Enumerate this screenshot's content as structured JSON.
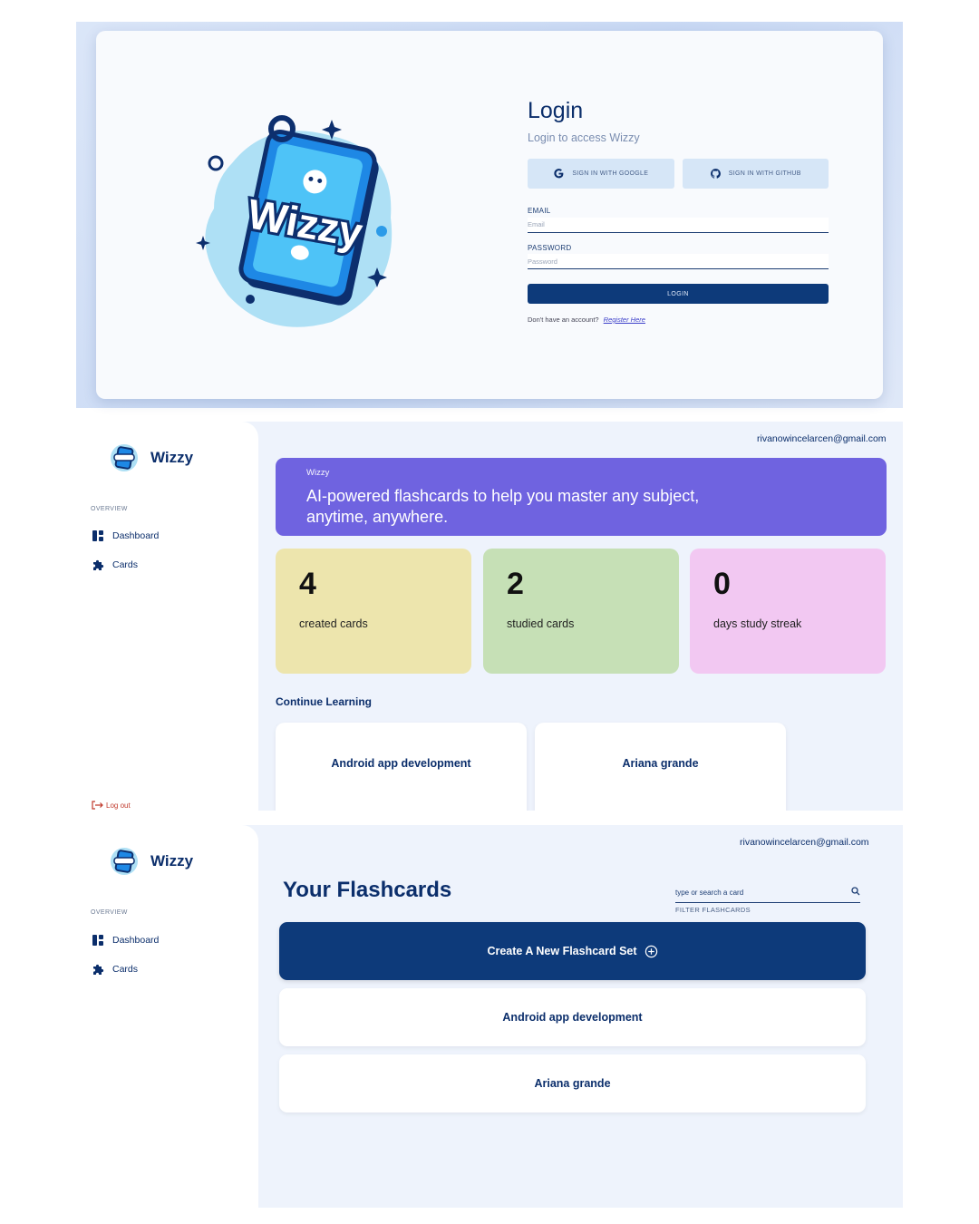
{
  "login": {
    "title": "Login",
    "subtitle": "Login to access Wizzy",
    "google_label": "SIGN IN WITH GOOGLE",
    "github_label": "SIGN IN WITH GITHUB",
    "email_label": "EMAIL",
    "email_placeholder": "Email",
    "password_label": "PASSWORD",
    "password_placeholder": "Password",
    "login_button": "LOGIN",
    "register_prompt": "Don't have an account?",
    "register_link": "Register Here",
    "logo_text": "Wizzy"
  },
  "sidebar": {
    "brand": "Wizzy",
    "section": "OVERVIEW",
    "items": [
      {
        "label": "Dashboard",
        "icon": "dashboard-icon"
      },
      {
        "label": "Cards",
        "icon": "puzzle-icon"
      }
    ],
    "logout": "Log out"
  },
  "user": {
    "email": "rivanowincelarcen@gmail.com"
  },
  "dashboard": {
    "hero_small": "Wizzy",
    "hero_text": "AI-powered flashcards to help you master any subject, anytime, anywhere.",
    "stats": [
      {
        "value": "4",
        "label": "created cards",
        "color": "#ede5ad"
      },
      {
        "value": "2",
        "label": "studied cards",
        "color": "#c6e0b6"
      },
      {
        "value": "0",
        "label": "days study streak",
        "color": "#f2c8f2"
      }
    ],
    "continue_title": "Continue Learning",
    "continue_items": [
      "Android app development",
      "Ariana grande"
    ]
  },
  "cards_page": {
    "title": "Your Flashcards",
    "search_placeholder": "type or search a card",
    "filter_label": "FILTER FLASHCARDS",
    "create_button": "Create A New Flashcard Set",
    "sets": [
      "Android app development",
      "Ariana grande"
    ]
  },
  "colors": {
    "primary": "#0d3a7a",
    "hero": "#6f63e0",
    "background": "#eef3fc"
  }
}
